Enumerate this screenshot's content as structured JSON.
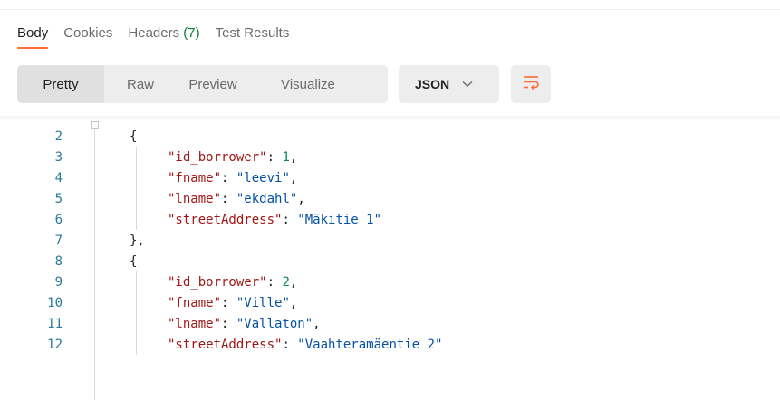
{
  "tabs": [
    {
      "label": "Body",
      "active": true
    },
    {
      "label": "Cookies",
      "active": false
    },
    {
      "label": "Headers",
      "count": "(7)",
      "active": false
    },
    {
      "label": "Test Results",
      "active": false
    }
  ],
  "view_modes": [
    "Pretty",
    "Raw",
    "Preview",
    "Visualize"
  ],
  "selected_view": "Pretty",
  "format_select": {
    "value": "JSON"
  },
  "icons": {
    "chevron": "chevron-down-icon",
    "wrap": "wrap-lines-icon",
    "fold": "fold-icon"
  },
  "colors": {
    "accent": "#ff6c37",
    "count": "#0a7c37",
    "key": "#a31515",
    "string": "#0451a5",
    "number": "#098658",
    "line_number": "#2b7a9a"
  },
  "code_lines": [
    {
      "n": "2",
      "parts": [
        {
          "t": "{",
          "c": "punct"
        }
      ]
    },
    {
      "n": "3",
      "parts": [
        {
          "t": "\"id_borrower\"",
          "c": "key"
        },
        {
          "t": ": ",
          "c": "punct"
        },
        {
          "t": "1",
          "c": "num"
        },
        {
          "t": ",",
          "c": "punct"
        }
      ]
    },
    {
      "n": "4",
      "parts": [
        {
          "t": "\"fname\"",
          "c": "key"
        },
        {
          "t": ": ",
          "c": "punct"
        },
        {
          "t": "\"leevi\"",
          "c": "str"
        },
        {
          "t": ",",
          "c": "punct"
        }
      ]
    },
    {
      "n": "5",
      "parts": [
        {
          "t": "\"lname\"",
          "c": "key"
        },
        {
          "t": ": ",
          "c": "punct"
        },
        {
          "t": "\"ekdahl\"",
          "c": "str"
        },
        {
          "t": ",",
          "c": "punct"
        }
      ]
    },
    {
      "n": "6",
      "parts": [
        {
          "t": "\"streetAddress\"",
          "c": "key"
        },
        {
          "t": ": ",
          "c": "punct"
        },
        {
          "t": "\"Mäkitie 1\"",
          "c": "str"
        }
      ]
    },
    {
      "n": "7",
      "parts": [
        {
          "t": "},",
          "c": "punct"
        }
      ]
    },
    {
      "n": "8",
      "parts": [
        {
          "t": "{",
          "c": "punct"
        }
      ]
    },
    {
      "n": "9",
      "parts": [
        {
          "t": "\"id_borrower\"",
          "c": "key"
        },
        {
          "t": ": ",
          "c": "punct"
        },
        {
          "t": "2",
          "c": "num"
        },
        {
          "t": ",",
          "c": "punct"
        }
      ]
    },
    {
      "n": "10",
      "parts": [
        {
          "t": "\"fname\"",
          "c": "key"
        },
        {
          "t": ": ",
          "c": "punct"
        },
        {
          "t": "\"Ville\"",
          "c": "str"
        },
        {
          "t": ",",
          "c": "punct"
        }
      ]
    },
    {
      "n": "11",
      "parts": [
        {
          "t": "\"lname\"",
          "c": "key"
        },
        {
          "t": ": ",
          "c": "punct"
        },
        {
          "t": "\"Vallaton\"",
          "c": "str"
        },
        {
          "t": ",",
          "c": "punct"
        }
      ]
    },
    {
      "n": "12",
      "parts": [
        {
          "t": "\"streetAddress\"",
          "c": "key"
        },
        {
          "t": ": ",
          "c": "punct"
        },
        {
          "t": "\"Vaahteramäentie 2\"",
          "c": "str"
        }
      ]
    }
  ]
}
